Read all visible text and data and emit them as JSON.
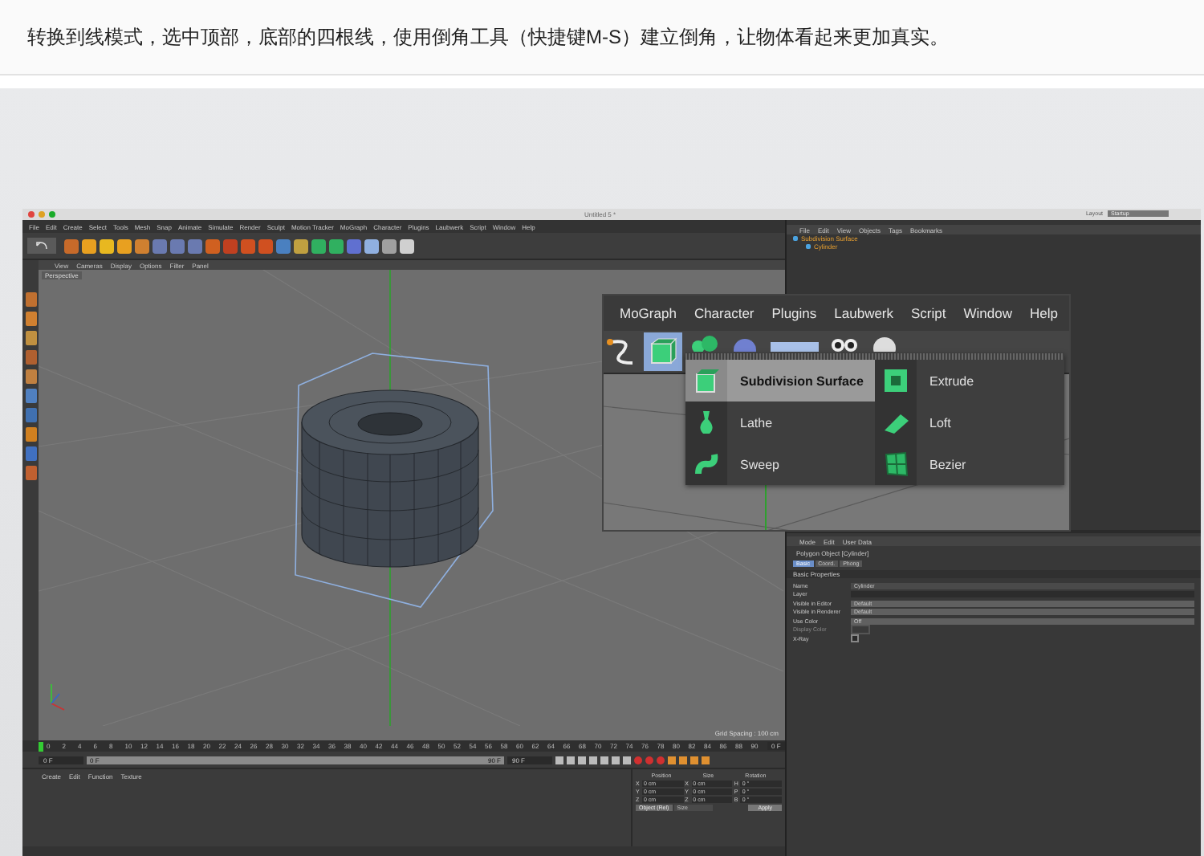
{
  "caption": "转换到线模式，选中顶部，底部的四根线，使用倒角工具（快捷键M-S）建立倒角，让物体看起来更加真实。",
  "app": {
    "title": "Untitled 5 *",
    "layout_label": "Layout",
    "layout_value": "Startup",
    "menu": [
      "File",
      "Edit",
      "Create",
      "Select",
      "Tools",
      "Mesh",
      "Snap",
      "Animate",
      "Simulate",
      "Render",
      "Sculpt",
      "Motion Tracker",
      "MoGraph",
      "Character",
      "Plugins",
      "Laubwerk",
      "Script",
      "Window",
      "Help"
    ],
    "viewport": {
      "menu": [
        "View",
        "Cameras",
        "Display",
        "Options",
        "Filter",
        "Panel"
      ],
      "camera": "Perspective",
      "grid_spacing": "Grid Spacing : 100 cm"
    },
    "timeline": {
      "ticks": [
        "0",
        "2",
        "4",
        "6",
        "8",
        "10",
        "12",
        "14",
        "16",
        "18",
        "20",
        "22",
        "24",
        "26",
        "28",
        "30",
        "32",
        "34",
        "36",
        "38",
        "40",
        "42",
        "44",
        "46",
        "48",
        "50",
        "52",
        "54",
        "56",
        "58",
        "60",
        "62",
        "64",
        "66",
        "68",
        "70",
        "72",
        "74",
        "76",
        "78",
        "80",
        "82",
        "84",
        "86",
        "88",
        "90"
      ],
      "frame_field": "0 F",
      "start": "0 F",
      "level": 1,
      "range_start": "0 F",
      "range_end": "90 F",
      "end": "90 F"
    },
    "materials": {
      "menu": [
        "Create",
        "Edit",
        "Function",
        "Texture"
      ]
    },
    "coordinates": {
      "headers": [
        "Position",
        "Size",
        "Rotation"
      ],
      "rows": [
        {
          "p_axis": "X",
          "position": "0 cm",
          "s_axis": "X",
          "size": "0 cm",
          "r_axis": "H",
          "rotation": "0 °"
        },
        {
          "p_axis": "Y",
          "position": "0 cm",
          "s_axis": "Y",
          "size": "0 cm",
          "r_axis": "P",
          "rotation": "0 °"
        },
        {
          "p_axis": "Z",
          "position": "0 cm",
          "s_axis": "Z",
          "size": "0 cm",
          "r_axis": "B",
          "rotation": "0 °"
        }
      ],
      "mode": "Object (Rel)",
      "size_mode": "Size",
      "apply": "Apply"
    },
    "object_manager": {
      "menu": [
        "File",
        "Edit",
        "View",
        "Objects",
        "Tags",
        "Bookmarks"
      ],
      "objects": [
        {
          "name": "Subdivision Surface",
          "selected": true,
          "children": [
            {
              "name": "Cylinder",
              "selected": true
            }
          ]
        }
      ]
    },
    "attributes": {
      "menu": [
        "Mode",
        "Edit",
        "User Data"
      ],
      "title": "Polygon Object [Cylinder]",
      "tabs": [
        {
          "label": "Basic",
          "selected": true
        },
        {
          "label": "Coord.",
          "selected": false
        },
        {
          "label": "Phong",
          "selected": false
        }
      ],
      "section": "Basic Properties",
      "fields": [
        {
          "kind": "text",
          "label": "Name",
          "value": "Cylinder",
          "disabled": false
        },
        {
          "kind": "layer",
          "label": "Layer",
          "disabled": false
        },
        {
          "kind": "dropdown",
          "label": "Visible in Editor",
          "value": "Default",
          "disabled": false
        },
        {
          "kind": "dropdown",
          "label": "Visible in Renderer",
          "value": "Default",
          "disabled": false
        },
        {
          "kind": "dropdown",
          "label": "Use Color",
          "value": "Off",
          "disabled": false
        },
        {
          "kind": "color",
          "label": "Display Color",
          "disabled": true
        },
        {
          "kind": "checkbox",
          "label": "X-Ray",
          "checked": false,
          "disabled": false
        }
      ]
    },
    "popup": {
      "menu": [
        "MoGraph",
        "Character",
        "Plugins",
        "Laubwerk",
        "Script",
        "Window",
        "Help"
      ],
      "items": [
        {
          "label": "Subdivision Surface",
          "selected": true
        },
        {
          "label": "Extrude",
          "selected": false
        },
        {
          "label": "Lathe",
          "selected": false
        },
        {
          "label": "Loft",
          "selected": false
        },
        {
          "label": "Sweep",
          "selected": false
        },
        {
          "label": "Bezier",
          "selected": false
        }
      ]
    }
  }
}
